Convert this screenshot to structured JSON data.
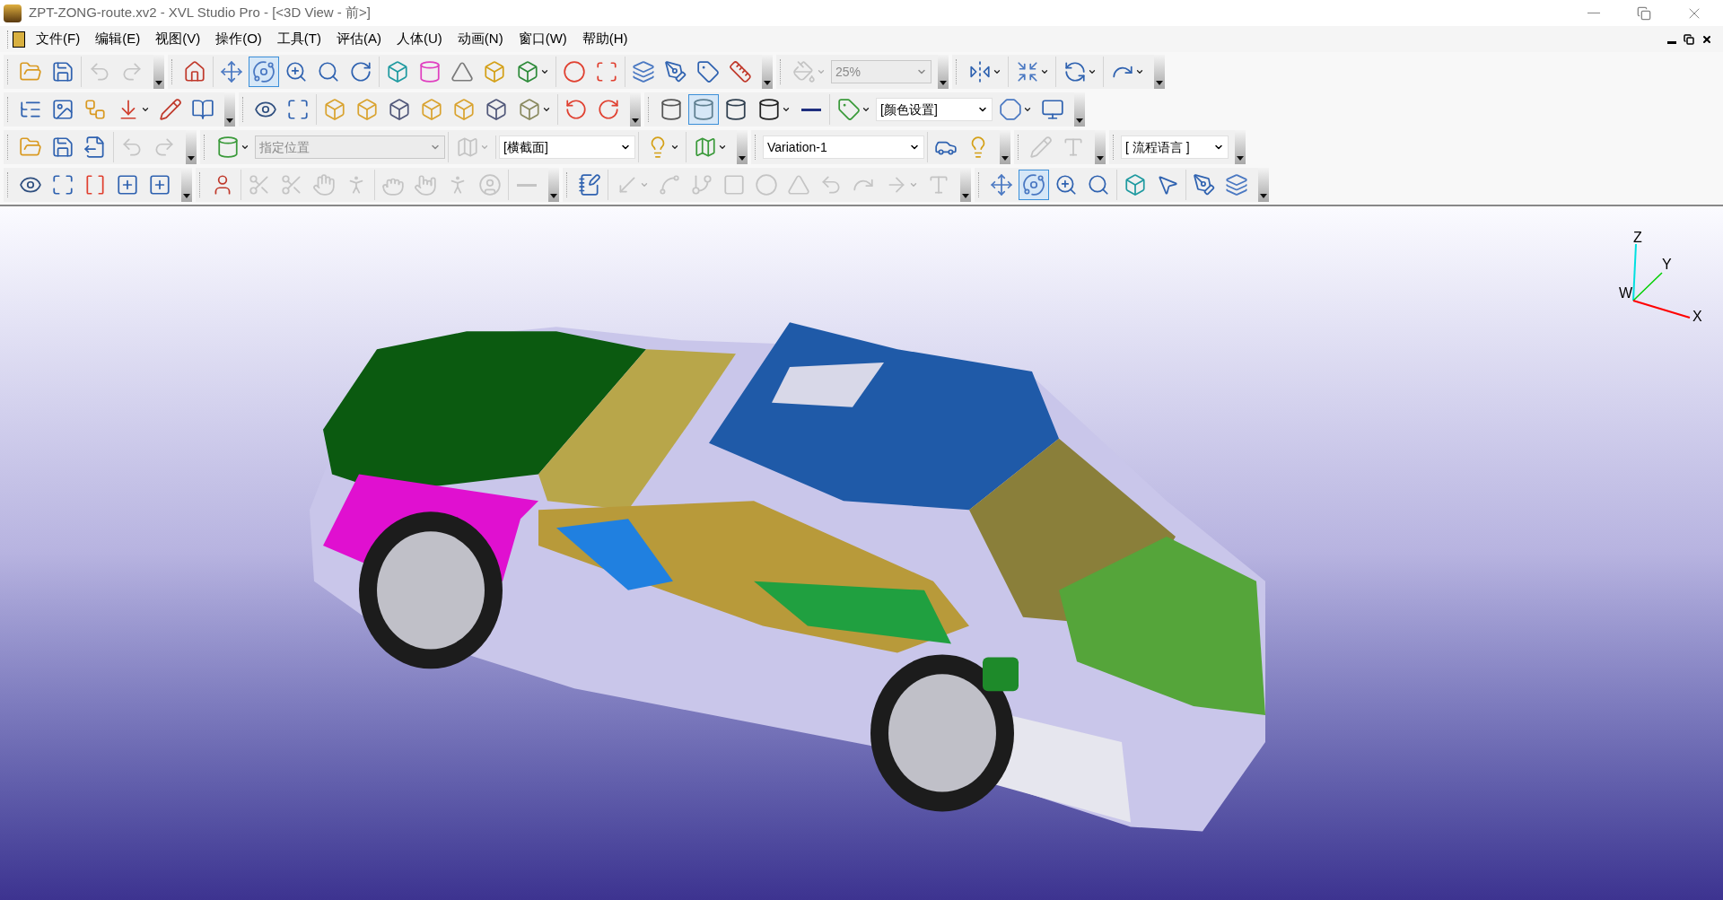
{
  "window": {
    "title": "ZPT-ZONG-route.xv2 - XVL Studio Pro - [<3D View - 前>]"
  },
  "menu": [
    "文件(F)",
    "编辑(E)",
    "视图(V)",
    "操作(O)",
    "工具(T)",
    "评估(A)",
    "人体(U)",
    "动画(N)",
    "窗口(W)",
    "帮助(H)"
  ],
  "toolbars": [
    {
      "bands": [
        [
          [
            {
              "kind": "button",
              "disabled": false,
              "selected": false,
              "dropdown": false
            },
            {
              "kind": "button",
              "disabled": false,
              "selected": false,
              "dropdown": false
            }
          ],
          [
            {
              "kind": "button",
              "disabled": true,
              "selected": false,
              "dropdown": false
            },
            {
              "kind": "button",
              "disabled": true,
              "selected": false,
              "dropdown": false
            }
          ]
        ],
        [
          [
            {
              "kind": "button",
              "disabled": false,
              "selected": false,
              "dropdown": false
            }
          ],
          [
            {
              "kind": "button",
              "disabled": false,
              "selected": false,
              "dropdown": false
            },
            {
              "kind": "button",
              "disabled": false,
              "selected": true,
              "dropdown": false
            },
            {
              "kind": "button",
              "disabled": false,
              "selected": false,
              "dropdown": false
            },
            {
              "kind": "button",
              "disabled": false,
              "selected": false,
              "dropdown": false
            },
            {
              "kind": "button",
              "disabled": false,
              "selected": false,
              "dropdown": false
            }
          ],
          [
            {
              "kind": "button",
              "disabled": false,
              "selected": false,
              "dropdown": false
            },
            {
              "kind": "button",
              "disabled": false,
              "selected": false,
              "dropdown": false
            },
            {
              "kind": "button",
              "disabled": false,
              "selected": false,
              "dropdown": false
            },
            {
              "kind": "button",
              "disabled": false,
              "selected": false,
              "dropdown": false
            },
            {
              "kind": "button",
              "disabled": false,
              "selected": false,
              "dropdown": true
            }
          ],
          [
            {
              "kind": "button",
              "disabled": false,
              "selected": false,
              "dropdown": false
            },
            {
              "kind": "button",
              "disabled": false,
              "selected": false,
              "dropdown": false
            }
          ],
          [
            {
              "kind": "button",
              "disabled": false,
              "selected": false,
              "dropdown": false
            },
            {
              "kind": "button",
              "disabled": false,
              "selected": false,
              "dropdown": false
            },
            {
              "kind": "button",
              "disabled": false,
              "selected": false,
              "dropdown": false
            },
            {
              "kind": "button",
              "disabled": false,
              "selected": false,
              "dropdown": false
            }
          ]
        ],
        [
          [
            {
              "kind": "button",
              "disabled": true,
              "selected": false,
              "dropdown": true
            },
            {
              "kind": "combo",
              "value": "25%",
              "disabled": true
            }
          ]
        ],
        [
          [
            {
              "kind": "button",
              "disabled": false,
              "selected": false,
              "dropdown": true
            }
          ],
          [
            {
              "kind": "button",
              "disabled": false,
              "selected": false,
              "dropdown": true
            }
          ],
          [
            {
              "kind": "button",
              "disabled": false,
              "selected": false,
              "dropdown": true
            }
          ],
          [
            {
              "kind": "button",
              "disabled": false,
              "selected": false,
              "dropdown": true
            }
          ]
        ]
      ]
    },
    {
      "bands": [
        [
          [
            {
              "kind": "button",
              "disabled": false,
              "selected": false,
              "dropdown": false
            },
            {
              "kind": "button",
              "disabled": false,
              "selected": false,
              "dropdown": false
            },
            {
              "kind": "button",
              "disabled": false,
              "selected": false,
              "dropdown": false
            },
            {
              "kind": "button",
              "disabled": false,
              "selected": false,
              "dropdown": true
            },
            {
              "kind": "button",
              "disabled": false,
              "selected": false,
              "dropdown": false
            },
            {
              "kind": "button",
              "disabled": false,
              "selected": false,
              "dropdown": false
            }
          ]
        ],
        [
          [
            {
              "kind": "button",
              "disabled": false,
              "selected": false,
              "dropdown": false
            },
            {
              "kind": "button",
              "disabled": false,
              "selected": false,
              "dropdown": false
            }
          ],
          [
            {
              "kind": "button",
              "disabled": false,
              "selected": false,
              "dropdown": false
            },
            {
              "kind": "button",
              "disabled": false,
              "selected": false,
              "dropdown": false
            },
            {
              "kind": "button",
              "disabled": false,
              "selected": false,
              "dropdown": false
            },
            {
              "kind": "button",
              "disabled": false,
              "selected": false,
              "dropdown": false
            },
            {
              "kind": "button",
              "disabled": false,
              "selected": false,
              "dropdown": false
            },
            {
              "kind": "button",
              "disabled": false,
              "selected": false,
              "dropdown": false
            },
            {
              "kind": "button",
              "disabled": false,
              "selected": false,
              "dropdown": true
            }
          ],
          [
            {
              "kind": "button",
              "disabled": false,
              "selected": false,
              "dropdown": false
            },
            {
              "kind": "button",
              "disabled": false,
              "selected": false,
              "dropdown": false
            }
          ]
        ],
        [
          [
            {
              "kind": "button",
              "disabled": false,
              "selected": false,
              "dropdown": false
            },
            {
              "kind": "button",
              "disabled": false,
              "selected": true,
              "dropdown": false
            },
            {
              "kind": "button",
              "disabled": false,
              "selected": false,
              "dropdown": false
            },
            {
              "kind": "button",
              "disabled": false,
              "selected": false,
              "dropdown": true
            },
            {
              "kind": "button",
              "disabled": false,
              "selected": false,
              "dropdown": false
            }
          ],
          [
            {
              "kind": "button",
              "disabled": false,
              "selected": false,
              "dropdown": true
            },
            {
              "kind": "combo",
              "value": "[颜色设置]",
              "disabled": false
            },
            {
              "kind": "button",
              "disabled": false,
              "selected": false,
              "dropdown": true
            },
            {
              "kind": "button",
              "disabled": false,
              "selected": false,
              "dropdown": false
            }
          ]
        ]
      ]
    },
    {
      "bands": [
        [
          [
            {
              "kind": "button",
              "disabled": false,
              "selected": false,
              "dropdown": false
            },
            {
              "kind": "button",
              "disabled": false,
              "selected": false,
              "dropdown": false
            },
            {
              "kind": "button",
              "disabled": false,
              "selected": false,
              "dropdown": false
            }
          ],
          [
            {
              "kind": "button",
              "disabled": true,
              "selected": false,
              "dropdown": false
            },
            {
              "kind": "button",
              "disabled": true,
              "selected": false,
              "dropdown": false
            }
          ]
        ],
        [
          [
            {
              "kind": "button",
              "disabled": false,
              "selected": false,
              "dropdown": true
            },
            {
              "kind": "combo",
              "value": "指定位置",
              "disabled": true
            }
          ],
          [
            {
              "kind": "button",
              "disabled": true,
              "selected": false,
              "dropdown": true
            }
          ],
          [
            {
              "kind": "combo",
              "value": "[横截面]",
              "disabled": false
            }
          ],
          [
            {
              "kind": "button",
              "disabled": false,
              "selected": false,
              "dropdown": true
            }
          ],
          [
            {
              "kind": "button",
              "disabled": false,
              "selected": false,
              "dropdown": true
            }
          ]
        ],
        [
          [
            {
              "kind": "combo",
              "value": "Variation-1",
              "disabled": false
            }
          ],
          [
            {
              "kind": "button",
              "disabled": false,
              "selected": false,
              "dropdown": false
            },
            {
              "kind": "button",
              "disabled": false,
              "selected": false,
              "dropdown": false
            }
          ]
        ],
        [
          [
            {
              "kind": "button",
              "disabled": true,
              "selected": false,
              "dropdown": false
            },
            {
              "kind": "button",
              "disabled": true,
              "selected": false,
              "dropdown": false
            }
          ]
        ],
        [
          [
            {
              "kind": "combo",
              "value": "[ 流程语言 ]",
              "disabled": false
            }
          ]
        ]
      ]
    },
    {
      "bands": [
        [
          [
            {
              "kind": "button",
              "disabled": false,
              "selected": false,
              "dropdown": false
            },
            {
              "kind": "button",
              "disabled": false,
              "selected": false,
              "dropdown": false
            },
            {
              "kind": "button",
              "disabled": false,
              "selected": false,
              "dropdown": false
            },
            {
              "kind": "button",
              "disabled": false,
              "selected": false,
              "dropdown": false
            },
            {
              "kind": "button",
              "disabled": false,
              "selected": false,
              "dropdown": false
            }
          ]
        ],
        [
          [
            {
              "kind": "button",
              "disabled": false,
              "selected": false,
              "dropdown": false
            }
          ],
          [
            {
              "kind": "button",
              "disabled": true,
              "selected": false,
              "dropdown": false
            },
            {
              "kind": "button",
              "disabled": true,
              "selected": false,
              "dropdown": false
            },
            {
              "kind": "button",
              "disabled": true,
              "selected": false,
              "dropdown": false
            },
            {
              "kind": "button",
              "disabled": true,
              "selected": false,
              "dropdown": false
            }
          ],
          [
            {
              "kind": "button",
              "disabled": true,
              "selected": false,
              "dropdown": false
            },
            {
              "kind": "button",
              "disabled": true,
              "selected": false,
              "dropdown": false
            },
            {
              "kind": "button",
              "disabled": true,
              "selected": false,
              "dropdown": false
            },
            {
              "kind": "button",
              "disabled": true,
              "selected": false,
              "dropdown": false
            }
          ],
          [
            {
              "kind": "button",
              "disabled": true,
              "selected": false,
              "dropdown": false
            }
          ]
        ],
        [
          [
            {
              "kind": "button",
              "disabled": false,
              "selected": false,
              "dropdown": false
            }
          ],
          [
            {
              "kind": "button",
              "disabled": true,
              "selected": false,
              "dropdown": true
            },
            {
              "kind": "button",
              "disabled": true,
              "selected": false,
              "dropdown": false
            },
            {
              "kind": "button",
              "disabled": true,
              "selected": false,
              "dropdown": false
            },
            {
              "kind": "button",
              "disabled": true,
              "selected": false,
              "dropdown": false
            },
            {
              "kind": "button",
              "disabled": true,
              "selected": false,
              "dropdown": false
            },
            {
              "kind": "button",
              "disabled": true,
              "selected": false,
              "dropdown": false
            },
            {
              "kind": "button",
              "disabled": true,
              "selected": false,
              "dropdown": false
            },
            {
              "kind": "button",
              "disabled": true,
              "selected": false,
              "dropdown": false
            },
            {
              "kind": "button",
              "disabled": true,
              "selected": false,
              "dropdown": true
            },
            {
              "kind": "button",
              "disabled": true,
              "selected": false,
              "dropdown": false
            }
          ]
        ],
        [
          [
            {
              "kind": "button",
              "disabled": false,
              "selected": false,
              "dropdown": false
            },
            {
              "kind": "button",
              "disabled": false,
              "selected": true,
              "dropdown": false
            },
            {
              "kind": "button",
              "disabled": false,
              "selected": false,
              "dropdown": false
            },
            {
              "kind": "button",
              "disabled": false,
              "selected": false,
              "dropdown": false
            }
          ],
          [
            {
              "kind": "button",
              "disabled": false,
              "selected": false,
              "dropdown": false
            },
            {
              "kind": "button",
              "disabled": false,
              "selected": false,
              "dropdown": false
            }
          ],
          [
            {
              "kind": "button",
              "disabled": false,
              "selected": false,
              "dropdown": false
            },
            {
              "kind": "button",
              "disabled": false,
              "selected": false,
              "dropdown": false
            }
          ]
        ]
      ]
    }
  ],
  "axes": {
    "labels": [
      "Z",
      "Y",
      "W",
      "X"
    ]
  }
}
